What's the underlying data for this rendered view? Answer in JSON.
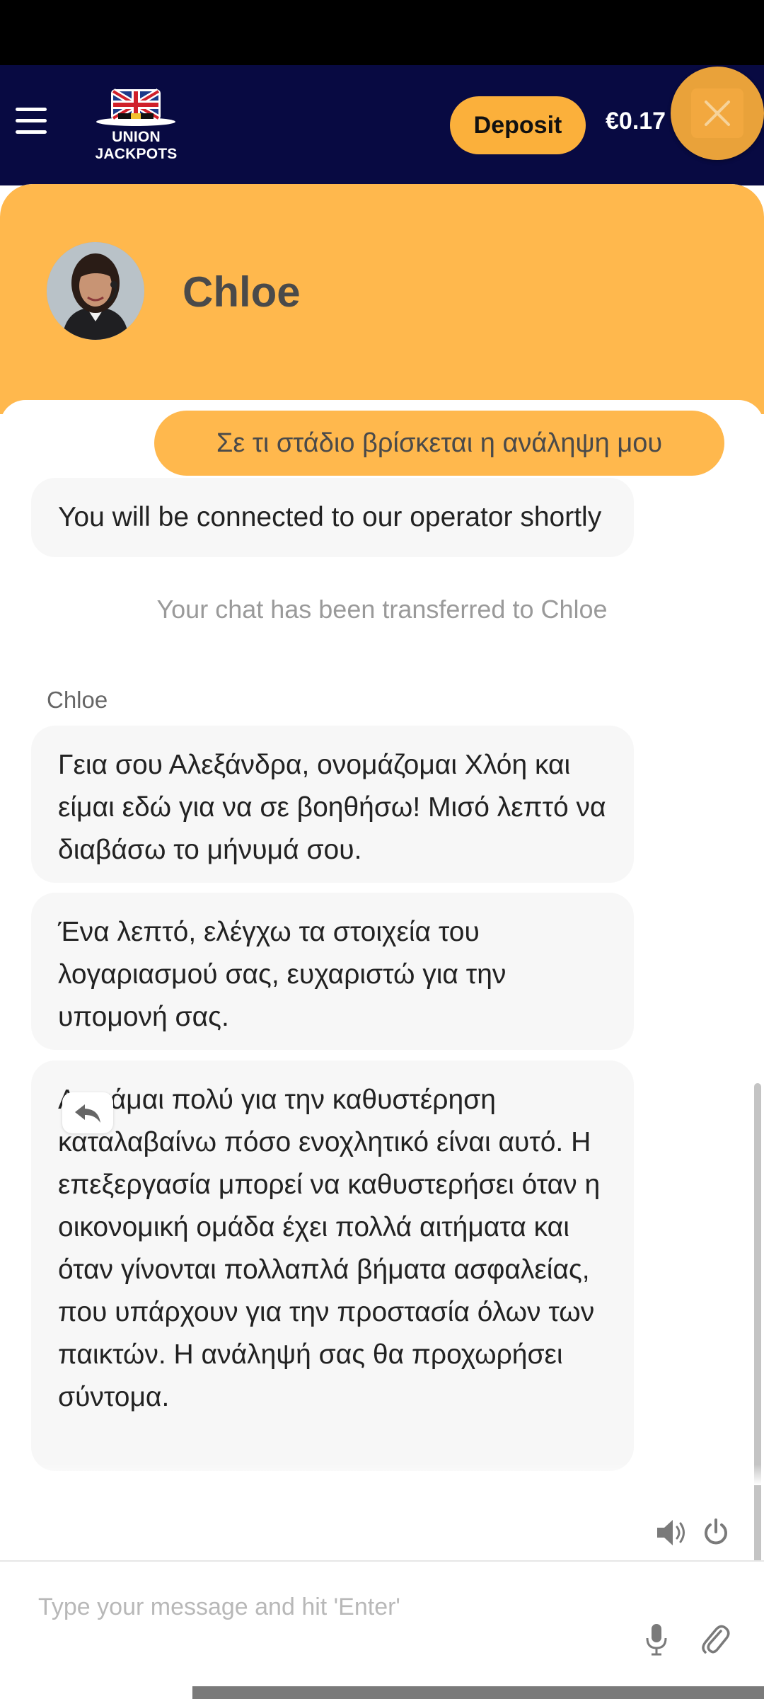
{
  "header": {
    "logo_text": "UNION JACKPOTS",
    "deposit_label": "Deposit",
    "balance": "€0.17"
  },
  "chat": {
    "agent_name": "Chloe",
    "messages": [
      {
        "type": "user",
        "text": "Σε τι στάδιο βρίσκεται η ανάληψη μου"
      },
      {
        "type": "bot",
        "text": "You will be connected to our operator shortly"
      },
      {
        "type": "system",
        "text": "Your chat has been transferred to Chloe"
      },
      {
        "type": "sender",
        "text": "Chloe"
      },
      {
        "type": "agent",
        "text": "Γεια σου Αλεξάνδρα, ονομάζομαι Χλόη και είμαι εδώ για να σε βοηθήσω! Μισό λεπτό να διαβάσω το μήνυμά σου."
      },
      {
        "type": "agent",
        "text": "Ένα λεπτό, ελέγχω τα στοιχεία του λογαριασμού σας, ευχαριστώ για την υπομονή σας."
      },
      {
        "type": "agent",
        "text": "Λυπάμαι πολύ για την καθυστέρηση καταλαβαίνω πόσο ενοχλητικό είναι αυτό. Η επεξεργασία μπορεί να καθυστερήσει όταν η οικονομική ομάδα έχει πολλά αιτήματα και όταν γίνονται πολλαπλά βήματα ασφαλείας, που υπάρχουν για την προστασία όλων των παικτών. Η ανάληψή σας θα προχωρήσει σύντομα."
      }
    ]
  },
  "composer": {
    "placeholder": "Type your message and hit 'Enter'"
  },
  "colors": {
    "header_bg": "#080a42",
    "accent": "#ffb84d",
    "deposit_bg": "#fbb03b",
    "bubble_bg": "#f7f7f7"
  },
  "icons": [
    "menu-icon",
    "close-icon",
    "reply-icon",
    "speaker-icon",
    "power-icon",
    "microphone-icon",
    "paperclip-icon"
  ]
}
